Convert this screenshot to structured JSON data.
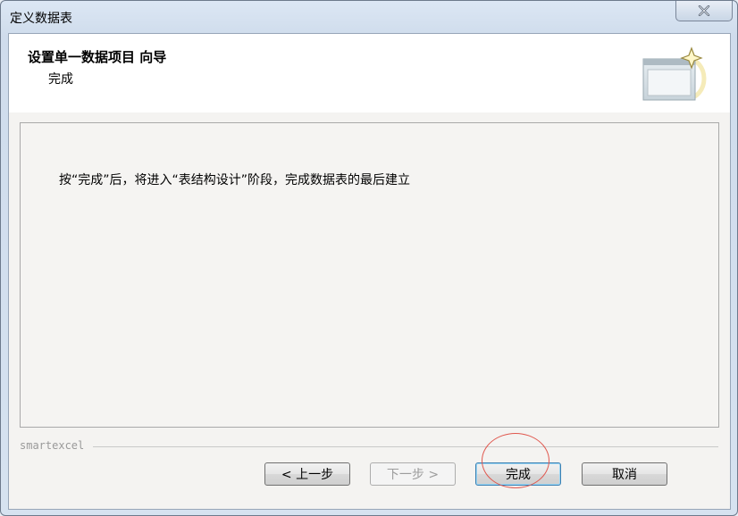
{
  "window": {
    "title": "定义数据表",
    "close_icon": "close-icon"
  },
  "header": {
    "title": "设置单一数据项目 向导",
    "subtitle": "完成",
    "icon": "wizard-window-icon"
  },
  "content": {
    "message": "按“完成”后，将进入“表结构设计”阶段，完成数据表的最后建立"
  },
  "brand": {
    "label": "smartexcel"
  },
  "buttons": {
    "back_label": "< 上一步",
    "next_label": "下一步 >",
    "finish_label": "完成",
    "cancel_label": "取消"
  },
  "colors": {
    "annotation": "#e0574e",
    "default_button_border": "#3c7fb1"
  }
}
